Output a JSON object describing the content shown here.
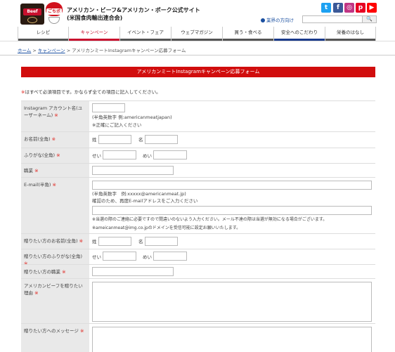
{
  "header": {
    "logo1_text": "Beef",
    "logo2_text": "ごちポ",
    "title_line1": "アメリカン・ビーフ&アメリカン・ポーク公式サイト",
    "title_line2": "(米国食肉輸出連合会)",
    "shops_link": "業界の方向け",
    "search_placeholder": "",
    "search_button": "🔍",
    "social": [
      "t",
      "f",
      "◎",
      "p",
      "▶"
    ]
  },
  "nav": {
    "items": [
      "レシピ",
      "キャンペーン",
      "イベント・フェア",
      "ウェブマガジン",
      "買う・食べる",
      "安全へのこだわり",
      "栄養のはなし"
    ]
  },
  "breadcrumb": {
    "home": "ホーム",
    "sep1": ">",
    "campaign": "キャンペーン",
    "sep2": ">",
    "current": "アメリカンミートInstagramキャンペーン応募フォーム"
  },
  "form": {
    "title": "アメリカンミートInstagramキャンペーン応募フォーム",
    "required_note_mark": "※",
    "required_note": "はすべて必須項目です。かならず全ての項目に記入してください。",
    "req_mark": "※",
    "fields": {
      "instagram": {
        "label": "Instagram アカウント名(ユーザーネーム)",
        "hint1": "(半角英数字 例:americanmeatjapan)",
        "hint2": "※正確にご記入ください"
      },
      "name": {
        "label": "お名前(全角)",
        "sei": "姓",
        "mei": "名"
      },
      "furigana": {
        "label": "ふりがな(全角)",
        "sei": "せい",
        "mei": "めい"
      },
      "occupation": {
        "label": "職業"
      },
      "email": {
        "label": "E-mail(半角)",
        "hint1": "(半角英数字　例:xxxxx@americanmeat.jp)",
        "hint2": "確認のため、再度E-mailアドレスをご入力ください",
        "hint3": "※当選の際のご連絡に必要ですので間違いのないよう入力ください。メール不達の際は当選が無効になる場合がございます。",
        "hint4": "※ameicanmeat@img.co.jpのドメインを受信可能に設定お願いいたします。"
      },
      "gift_name": {
        "label": "贈りたい方のお名前(全角)",
        "sei": "姓",
        "mei": "名"
      },
      "gift_furigana": {
        "label": "贈りたい方のふりがな(全角)",
        "sei": "せい",
        "mei": "めい"
      },
      "gift_occupation": {
        "label": "贈りたい方の職業"
      },
      "reason": {
        "label": "アメリカンビーフを贈りたい理由"
      },
      "message": {
        "label": "贈りたい方へのメッセージ"
      }
    }
  }
}
